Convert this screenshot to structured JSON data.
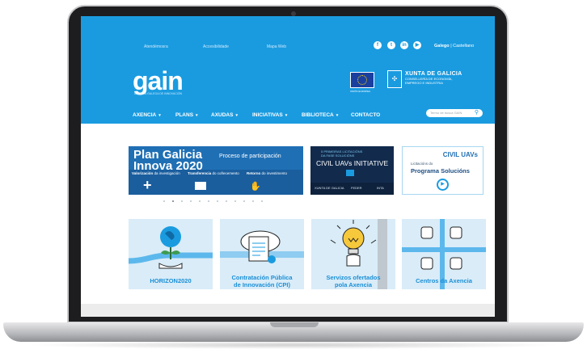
{
  "topbar": {
    "links": [
      "Atendémosra",
      "Accesibilidade",
      "Mapa Web"
    ],
    "social_icons": [
      "facebook-icon",
      "twitter-icon",
      "linkedin-icon",
      "youtube-icon"
    ],
    "lang_active": "Galego",
    "lang_sep": "|",
    "lang_other": "Castellano"
  },
  "brand": {
    "logo_text": "gain",
    "logo_sub": "AXENCIA GALEGA DE INNOVACIÓN",
    "eu_label": "UNIÓN EUROPEA",
    "xunta_title": "XUNTA DE GALICIA",
    "xunta_line1": "CONSELLERÍA DE ECONOMÍA,",
    "xunta_line2": "EMPREGO E INDUSTRIA"
  },
  "nav": {
    "items": [
      {
        "label": "AXENCIA",
        "caret": "▾"
      },
      {
        "label": "PLANS",
        "caret": "▾"
      },
      {
        "label": "AXUDAS",
        "caret": "▾"
      },
      {
        "label": "INICIATIVAS",
        "caret": "▾"
      },
      {
        "label": "BIBLIOTECA",
        "caret": "▾"
      },
      {
        "label": "CONTACTO",
        "caret": ""
      }
    ],
    "search_placeholder": "Termo de busca GAIN",
    "search_icon": "search-icon"
  },
  "slides": {
    "main": {
      "title_line1": "Plan Galicia",
      "title_line2": "Innova 2020",
      "process": "Proceso de participación",
      "col1_title": "Valorización",
      "col1_sub": "da investigación",
      "col2_title": "Transferencia",
      "col2_sub": "do coñecemento",
      "col3_title": "Retorno",
      "col3_sub": "do investimento",
      "plus": "+",
      "hand_icon": "hand-icon"
    },
    "civil": {
      "top1": "5 PRIMEIRAS LICITACIÓNS",
      "top2": "DA FASE SOLUCIÓNS",
      "name": "CIVIL UAVs INITIATIVE",
      "foot1": "XUNTA DE GALICIA",
      "foot2": "FEDER",
      "foot3": "INTA"
    },
    "uav": {
      "title": "CIVIL UAVs",
      "lic": "Licitacións do",
      "prog": "Programa Solucións",
      "play": "▶"
    },
    "dot_count": 12,
    "active_dot": 2
  },
  "tiles": [
    {
      "label": "HORIZON2020",
      "icon": "globe-plant-icon"
    },
    {
      "label_line1": "Contratación Pública",
      "label_line2": "de Innovación (CPI)",
      "icon": "document-cloud-icon"
    },
    {
      "label_line1": "Servizos ofertados",
      "label_line2": "pola Axencia",
      "icon": "lightbulb-hand-icon"
    },
    {
      "label": "Centros da Axencia",
      "icon": "hands-network-icon"
    }
  ],
  "colors": {
    "header": "#1a9be0",
    "tile_bg": "#d9ecf8",
    "accent": "#1a8fd6"
  }
}
